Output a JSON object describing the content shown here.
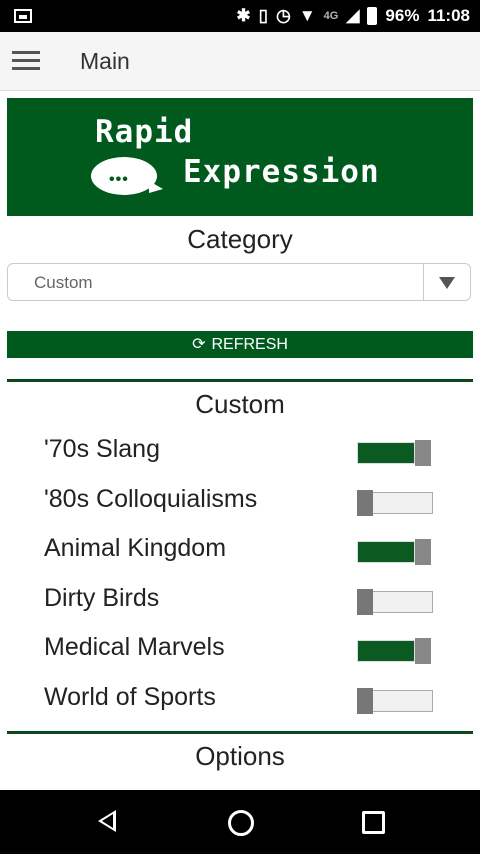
{
  "status_bar": {
    "network": "4G",
    "battery": "96%",
    "time": "11:08"
  },
  "app_bar": {
    "title": "Main"
  },
  "banner": {
    "line1": "Rapid",
    "line2": "Expression",
    "dots": "•••"
  },
  "category": {
    "title": "Category",
    "selected": "Custom"
  },
  "refresh": {
    "label": "REFRESH"
  },
  "custom_section": {
    "title": "Custom",
    "items": [
      {
        "label": "'70s Slang",
        "enabled": true
      },
      {
        "label": "'80s Colloquialisms",
        "enabled": false
      },
      {
        "label": "Animal Kingdom",
        "enabled": true
      },
      {
        "label": "Dirty Birds",
        "enabled": false
      },
      {
        "label": "Medical Marvels",
        "enabled": true
      },
      {
        "label": "World of Sports",
        "enabled": false
      }
    ]
  },
  "options": {
    "title": "Options"
  },
  "colors": {
    "brand_green": "#005a1e",
    "toggle_on": "#0a5a22"
  }
}
